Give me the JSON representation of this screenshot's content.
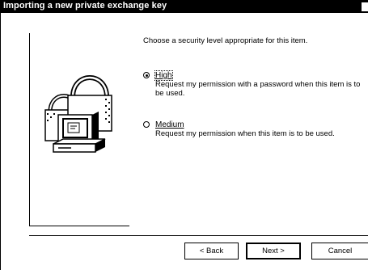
{
  "window": {
    "title": "Importing a new private exchange key"
  },
  "content": {
    "prompt": "Choose a security level appropriate for this item.",
    "options": [
      {
        "label": "High",
        "description": "Request my permission with a password when this item is to be used.",
        "selected": true
      },
      {
        "label": "Medium",
        "description": "Request my permission when this item is to be used.",
        "selected": false
      }
    ]
  },
  "buttons": {
    "back": "< Back",
    "next": "Next >",
    "cancel": "Cancel"
  },
  "icons": [
    "padlock-computer-icon"
  ]
}
